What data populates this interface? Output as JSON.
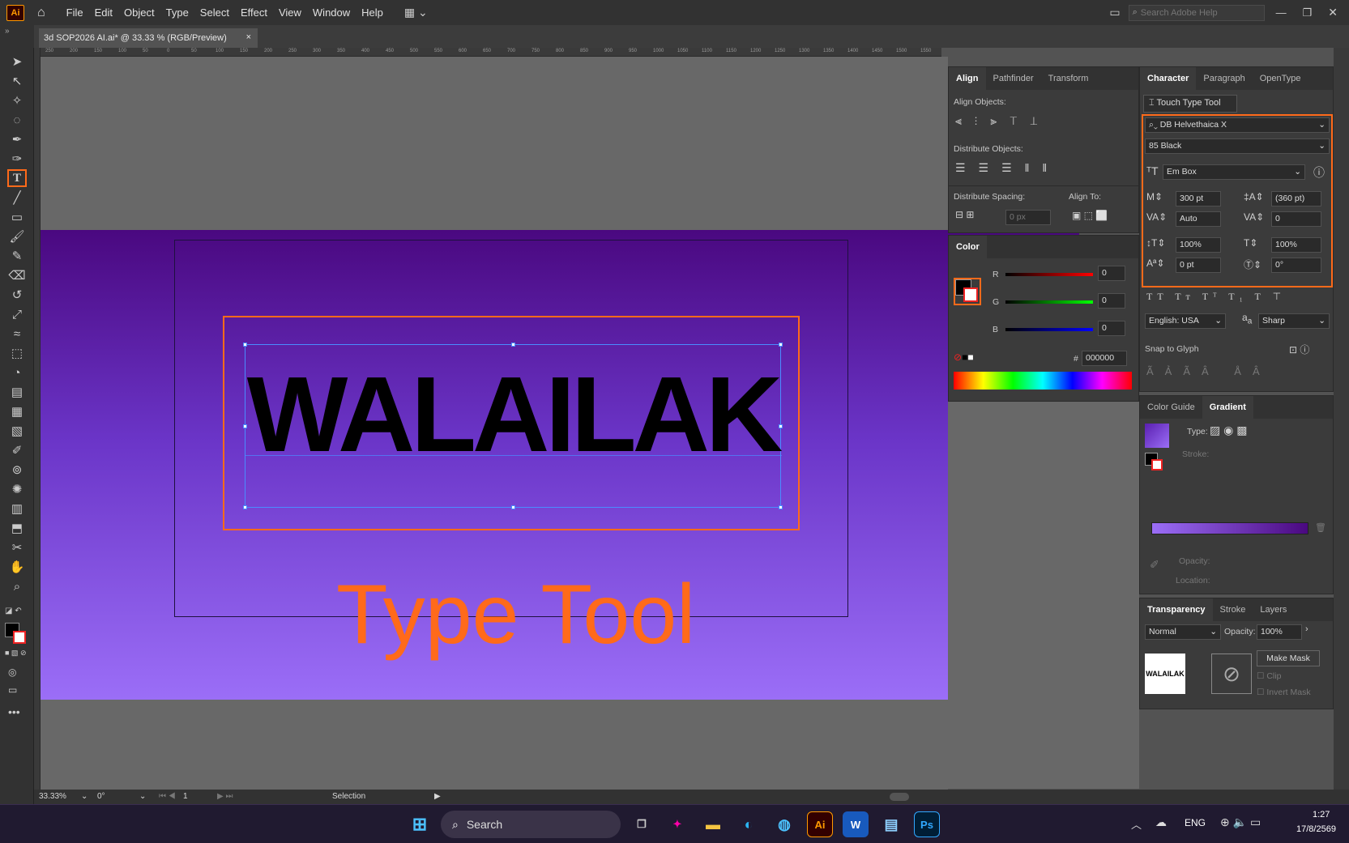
{
  "app": {
    "logo": "Ai",
    "menus": [
      "File",
      "Edit",
      "Object",
      "Type",
      "Select",
      "Effect",
      "View",
      "Window",
      "Help"
    ],
    "search_placeholder": "Search Adobe Help"
  },
  "document": {
    "tab_title": "3d SOP2026 AI.ai* @ 33.33 % (RGB/Preview)",
    "close": "×"
  },
  "canvas": {
    "main_text": "WALAILAK",
    "caption": "Type Tool",
    "caption_color": "#ff6a1a",
    "artboard_gradient": [
      "#4a0880",
      "#9b6ef7"
    ]
  },
  "align_panel": {
    "tabs": [
      "Align",
      "Pathfinder",
      "Transform"
    ],
    "align_objects": "Align Objects:",
    "distribute_objects": "Distribute Objects:",
    "distribute_spacing": "Distribute Spacing:",
    "align_to": "Align To:",
    "spacing_value": "0 px"
  },
  "color_panel": {
    "tab": "Color",
    "r_label": "R",
    "g_label": "G",
    "b_label": "B",
    "r": "0",
    "g": "0",
    "b": "0",
    "hash": "#",
    "hex": "000000"
  },
  "character_panel": {
    "tabs": [
      "Character",
      "Paragraph",
      "OpenType"
    ],
    "touch_type": "Touch Type Tool",
    "font_family": "DB Helvethaica X",
    "font_style": "85 Black",
    "em_box": "Em Box",
    "font_size": "300 pt",
    "leading": "(360 pt)",
    "kerning": "Auto",
    "tracking": "0",
    "vscale": "100%",
    "hscale": "100%",
    "baseline": "0 pt",
    "rotation": "0°",
    "language": "English: USA",
    "antialias": "Sharp",
    "antialias_prefix": "a",
    "antialias_sub": "a",
    "snap_to_glyph": "Snap to Glyph"
  },
  "gradient_panel": {
    "tabs": [
      "Color Guide",
      "Gradient"
    ],
    "type": "Type:",
    "stroke": "Stroke:",
    "opacity": "Opacity:",
    "location": "Location:"
  },
  "transparency_panel": {
    "tabs": [
      "Transparency",
      "Stroke",
      "Layers"
    ],
    "blend_mode": "Normal",
    "opacity_label": "Opacity:",
    "opacity": "100%",
    "thumb_text": "WALAILAK",
    "make_mask": "Make Mask",
    "clip": "Clip",
    "invert_mask": "Invert Mask"
  },
  "status": {
    "zoom": "33.33%",
    "rotation": "0°",
    "artboard": "1",
    "tool": "Selection"
  },
  "taskbar": {
    "search": "Search",
    "lang": "ENG",
    "time": "1:27",
    "date": "17/8/2569"
  },
  "ruler_ticks": [
    "250",
    "200",
    "150",
    "100",
    "50",
    "0",
    "50",
    "100",
    "150",
    "200",
    "250",
    "300",
    "350",
    "400",
    "450",
    "500",
    "550",
    "600",
    "650",
    "700",
    "750",
    "800",
    "850",
    "900",
    "950",
    "1000",
    "1050",
    "1100",
    "1150",
    "1200",
    "1250",
    "1300",
    "1350",
    "1400",
    "1450",
    "1500",
    "1550"
  ]
}
